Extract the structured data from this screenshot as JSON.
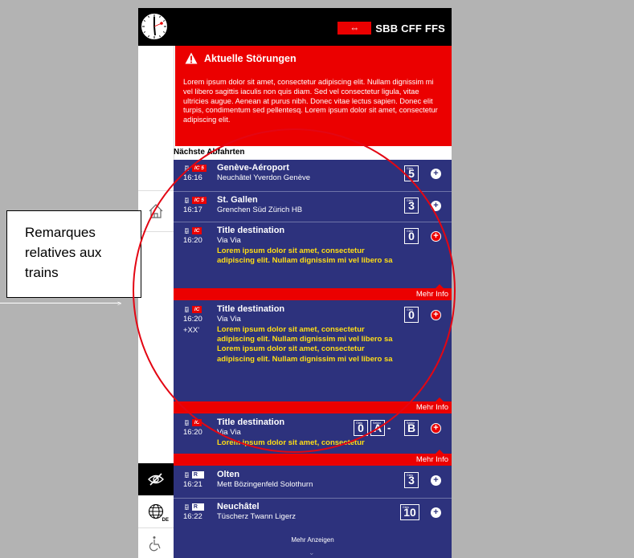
{
  "header": {
    "logo_flag": "⇔",
    "logo_text": "SBB CFF FFS"
  },
  "sidebar": {
    "home_icon": "home-icon",
    "eye_icon": "eye-off-icon",
    "globe_icon": "globe-icon",
    "language": "DE",
    "accessibility_icon": "wheelchair-icon"
  },
  "alert": {
    "title": "Aktuelle Störungen",
    "body": "Lorem ipsum dolor sit amet, consectetur adipiscing elit. Nullam dignissim mi vel libero sagittis iaculis non quis diam. Sed vel consectetur ligula, vitae ultricies augue. Aenean at purus nibh. Donec vitae lectus sapien. Donec elit turpis, condimentum sed pellentesq. Lorem ipsum dolor sit amet, consectetur adipiscing elit."
  },
  "next_departures_label": "Nächste Abfahrten",
  "rows": [
    {
      "product": "IC 5",
      "time": "16:16",
      "destination": "Genève-Aéroport",
      "via": "Neuchâtel  Yverdon  Genève",
      "track": "5",
      "plus_style": "white"
    },
    {
      "product": "IC 5",
      "time": "16:17",
      "destination": "St. Gallen",
      "via": "Grenchen Süd  Zürich HB",
      "track": "3",
      "plus_style": "white"
    },
    {
      "product": "IC",
      "time": "16:20",
      "destination": "Title destination",
      "via": "Via  Via",
      "note": "Lorem ipsum dolor sit amet, consectetur adipiscing elit. Nullam dignissim mi vel libero sa",
      "track": "0",
      "plus_style": "red"
    },
    {
      "product": "IC",
      "time": "16:20",
      "delay": "+XX'",
      "destination": "Title destination",
      "via": "Via  Via",
      "note": "Lorem ipsum dolor sit amet, consectetur adipiscing elit. Nullam dignissim mi vel libero sa Lorem ipsum dolor sit amet, consectetur adipiscing elit. Nullam dignissim mi vel libero sa",
      "track": "0",
      "plus_style": "red"
    },
    {
      "product": "IC",
      "time": "16:20",
      "destination": "Title destination",
      "via": "Via  Via",
      "note": "Lorem ipsum dolor sit amet, consectetur",
      "track": "0",
      "track_a": "A",
      "track_dash": "-",
      "track_b": "B",
      "plus_style": "red"
    },
    {
      "product": "R",
      "time": "16:21",
      "destination": "Olten",
      "via": "Mett  Bözingenfeld  Solothurn",
      "track": "3",
      "plus_style": "white"
    },
    {
      "product": "R",
      "time": "16:22",
      "destination": "Neuchâtel",
      "via": "Tüscherz  Twann  Ligerz",
      "track": "10",
      "plus_style": "white"
    }
  ],
  "mehr_info": "Mehr Info",
  "mehr_anzeigen": "Mehr Anzeigen",
  "annotation": {
    "line1": "Remarques",
    "line2": "relatives aux",
    "line3": "trains"
  },
  "colors": {
    "sbb_red": "#eb0000",
    "board_blue": "#2d327d",
    "note_yellow": "#ffde15"
  }
}
